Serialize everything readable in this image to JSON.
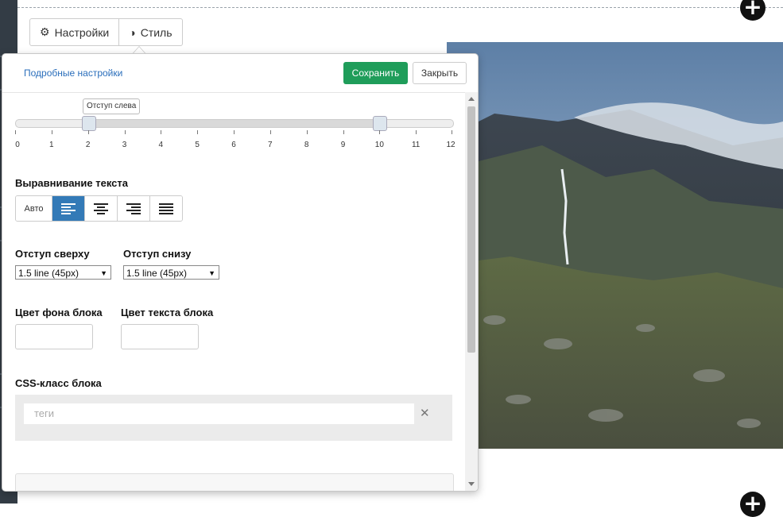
{
  "tabs": {
    "settings_label": "Настройки",
    "style_label": "Стиль",
    "settings_icon": "gear-icon",
    "style_icon": "half-circle-icon"
  },
  "panel": {
    "advanced_link": "Подробные настройки",
    "save_label": "Сохранить",
    "close_label": "Закрыть",
    "save_color": "#1f9d5a"
  },
  "slider": {
    "tooltip": "Отступ слева",
    "min": 0,
    "max": 12,
    "tick_labels": [
      "0",
      "1",
      "2",
      "3",
      "4",
      "5",
      "6",
      "7",
      "8",
      "9",
      "10",
      "11",
      "12"
    ],
    "left_value": 2,
    "right_value": 10
  },
  "text_align": {
    "label": "Выравнивание текста",
    "auto_label": "Авто",
    "options": [
      "align-left-icon",
      "align-center-icon",
      "align-right-icon",
      "align-justify-icon"
    ],
    "active": "align-left-icon",
    "active_color": "#337ab7"
  },
  "padding": {
    "top_label": "Отступ сверху",
    "top_value": "1.5 line (45px)",
    "bottom_label": "Отступ снизу",
    "bottom_value": "1.5 line (45px)"
  },
  "colors": {
    "bg_label": "Цвет фона блока",
    "bg_value": "",
    "text_label": "Цвет текста блока",
    "text_value": ""
  },
  "css_class": {
    "label": "CSS-класс блока",
    "placeholder": "теги",
    "clear_icon": "close-icon"
  }
}
